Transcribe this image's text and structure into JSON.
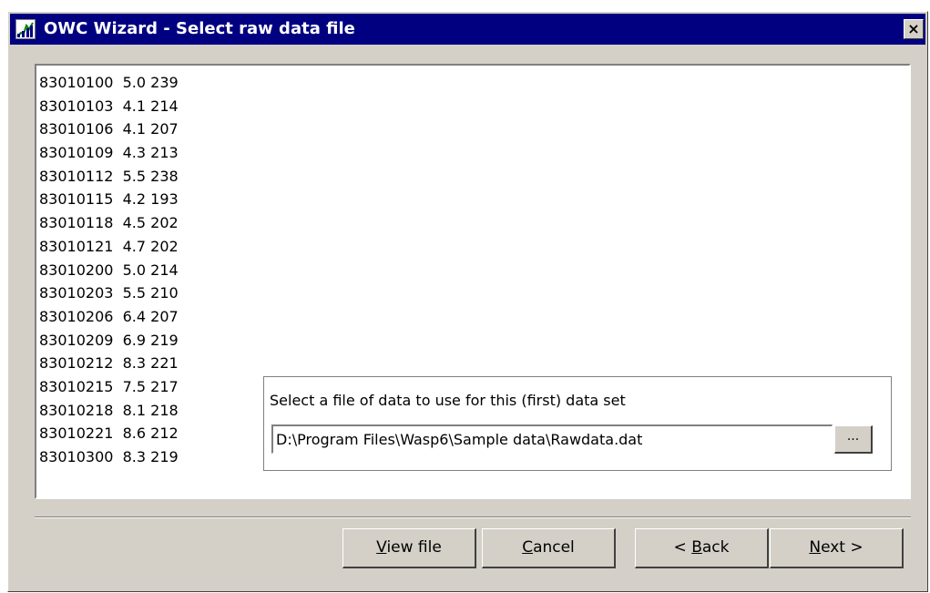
{
  "window": {
    "title": "OWC Wizard - Select raw data file",
    "close_glyph": "×",
    "app_icon": "chart-icon"
  },
  "data_preview": {
    "lines": [
      "83010100  5.0 239",
      "83010103  4.1 214",
      "83010106  4.1 207",
      "83010109  4.3 213",
      "83010112  5.5 238",
      "83010115  4.2 193",
      "83010118  4.5 202",
      "83010121  4.7 202",
      "83010200  5.0 214",
      "83010203  5.5 210",
      "83010206  6.4 207",
      "83010209  6.9 219",
      "83010212  8.3 221",
      "83010215  7.5 217",
      "83010218  8.1 218",
      "83010221  8.6 212",
      "83010300  8.3 219"
    ]
  },
  "file_select": {
    "label": "Select a file of data to use for this (first) data set",
    "path": "D:\\Program Files\\Wasp6\\Sample data\\Rawdata.dat",
    "browse_label": "..."
  },
  "buttons": {
    "view_file": {
      "mnemonic": "V",
      "rest": "iew file"
    },
    "cancel": {
      "mnemonic": "C",
      "rest": "ancel"
    },
    "back": {
      "prefix": "< ",
      "mnemonic": "B",
      "rest": "ack"
    },
    "next": {
      "mnemonic": "N",
      "rest": "ext >"
    }
  }
}
